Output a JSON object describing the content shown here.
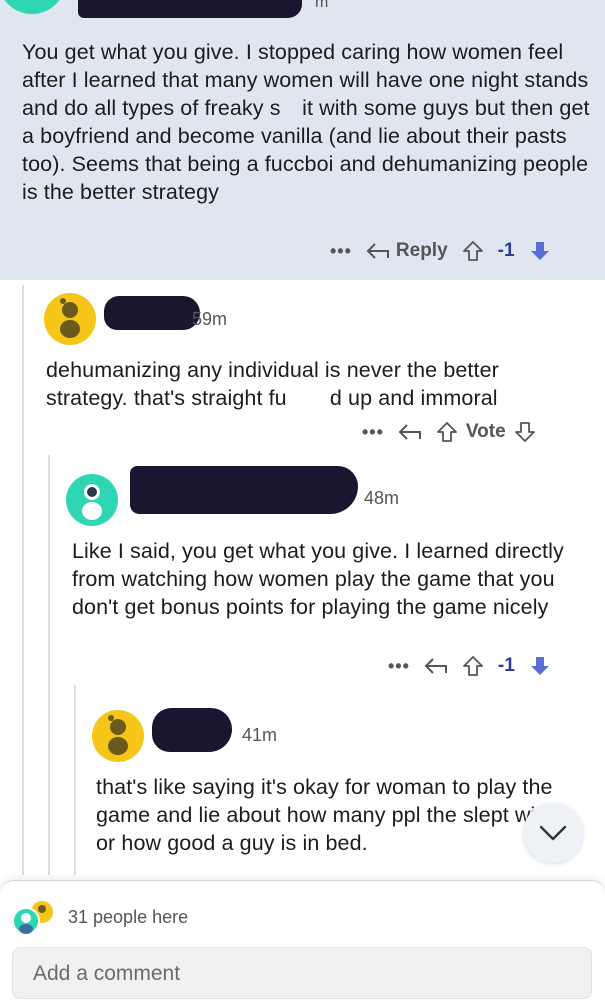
{
  "comment1": {
    "time_fragment": "m",
    "body": "You get what you give. I stopped caring how women feel after I learned that many women will have one night stands and do all types of freaky s it with some guys but then get a boyfriend and become vanilla (and lie about their pasts too). Seems that being a fuccboi and dehumanizing people is the better strategy",
    "more_label": "•••",
    "reply_label": "Reply",
    "score": "-1"
  },
  "comment2": {
    "time": "59m",
    "body": "dehumanizing any individual is never the better strategy. that's straight fu  d up and immoral",
    "more_label": "•••",
    "vote_label": "Vote"
  },
  "comment3": {
    "time": "48m",
    "body": "Like I said, you get what you give. I learned directly from watching how women play the game that you don't get bonus points for playing the game nicely",
    "more_label": "•••",
    "score": "-1"
  },
  "comment4": {
    "time": "41m",
    "body": "that's like saying it's okay for woman to play the game and lie about how many ppl the slept with or how good a guy is in bed."
  },
  "footer": {
    "people_here": "31 people here",
    "comment_placeholder": "Add a comment"
  },
  "icons": {
    "reply": "reply-arrow-icon",
    "upvote": "upvote-arrow-icon",
    "downvote": "downvote-arrow-icon",
    "collapse": "chevron-down-icon",
    "avatar": "snoo-avatar-icon"
  },
  "colors": {
    "highlight_bg": "#dfe6f0",
    "downvote_active": "#5a6fd6",
    "score": "#2f3c8f",
    "avatar_yellow": "#f5c518",
    "avatar_teal": "#2fd6b3",
    "redaction": "#1a1630"
  }
}
